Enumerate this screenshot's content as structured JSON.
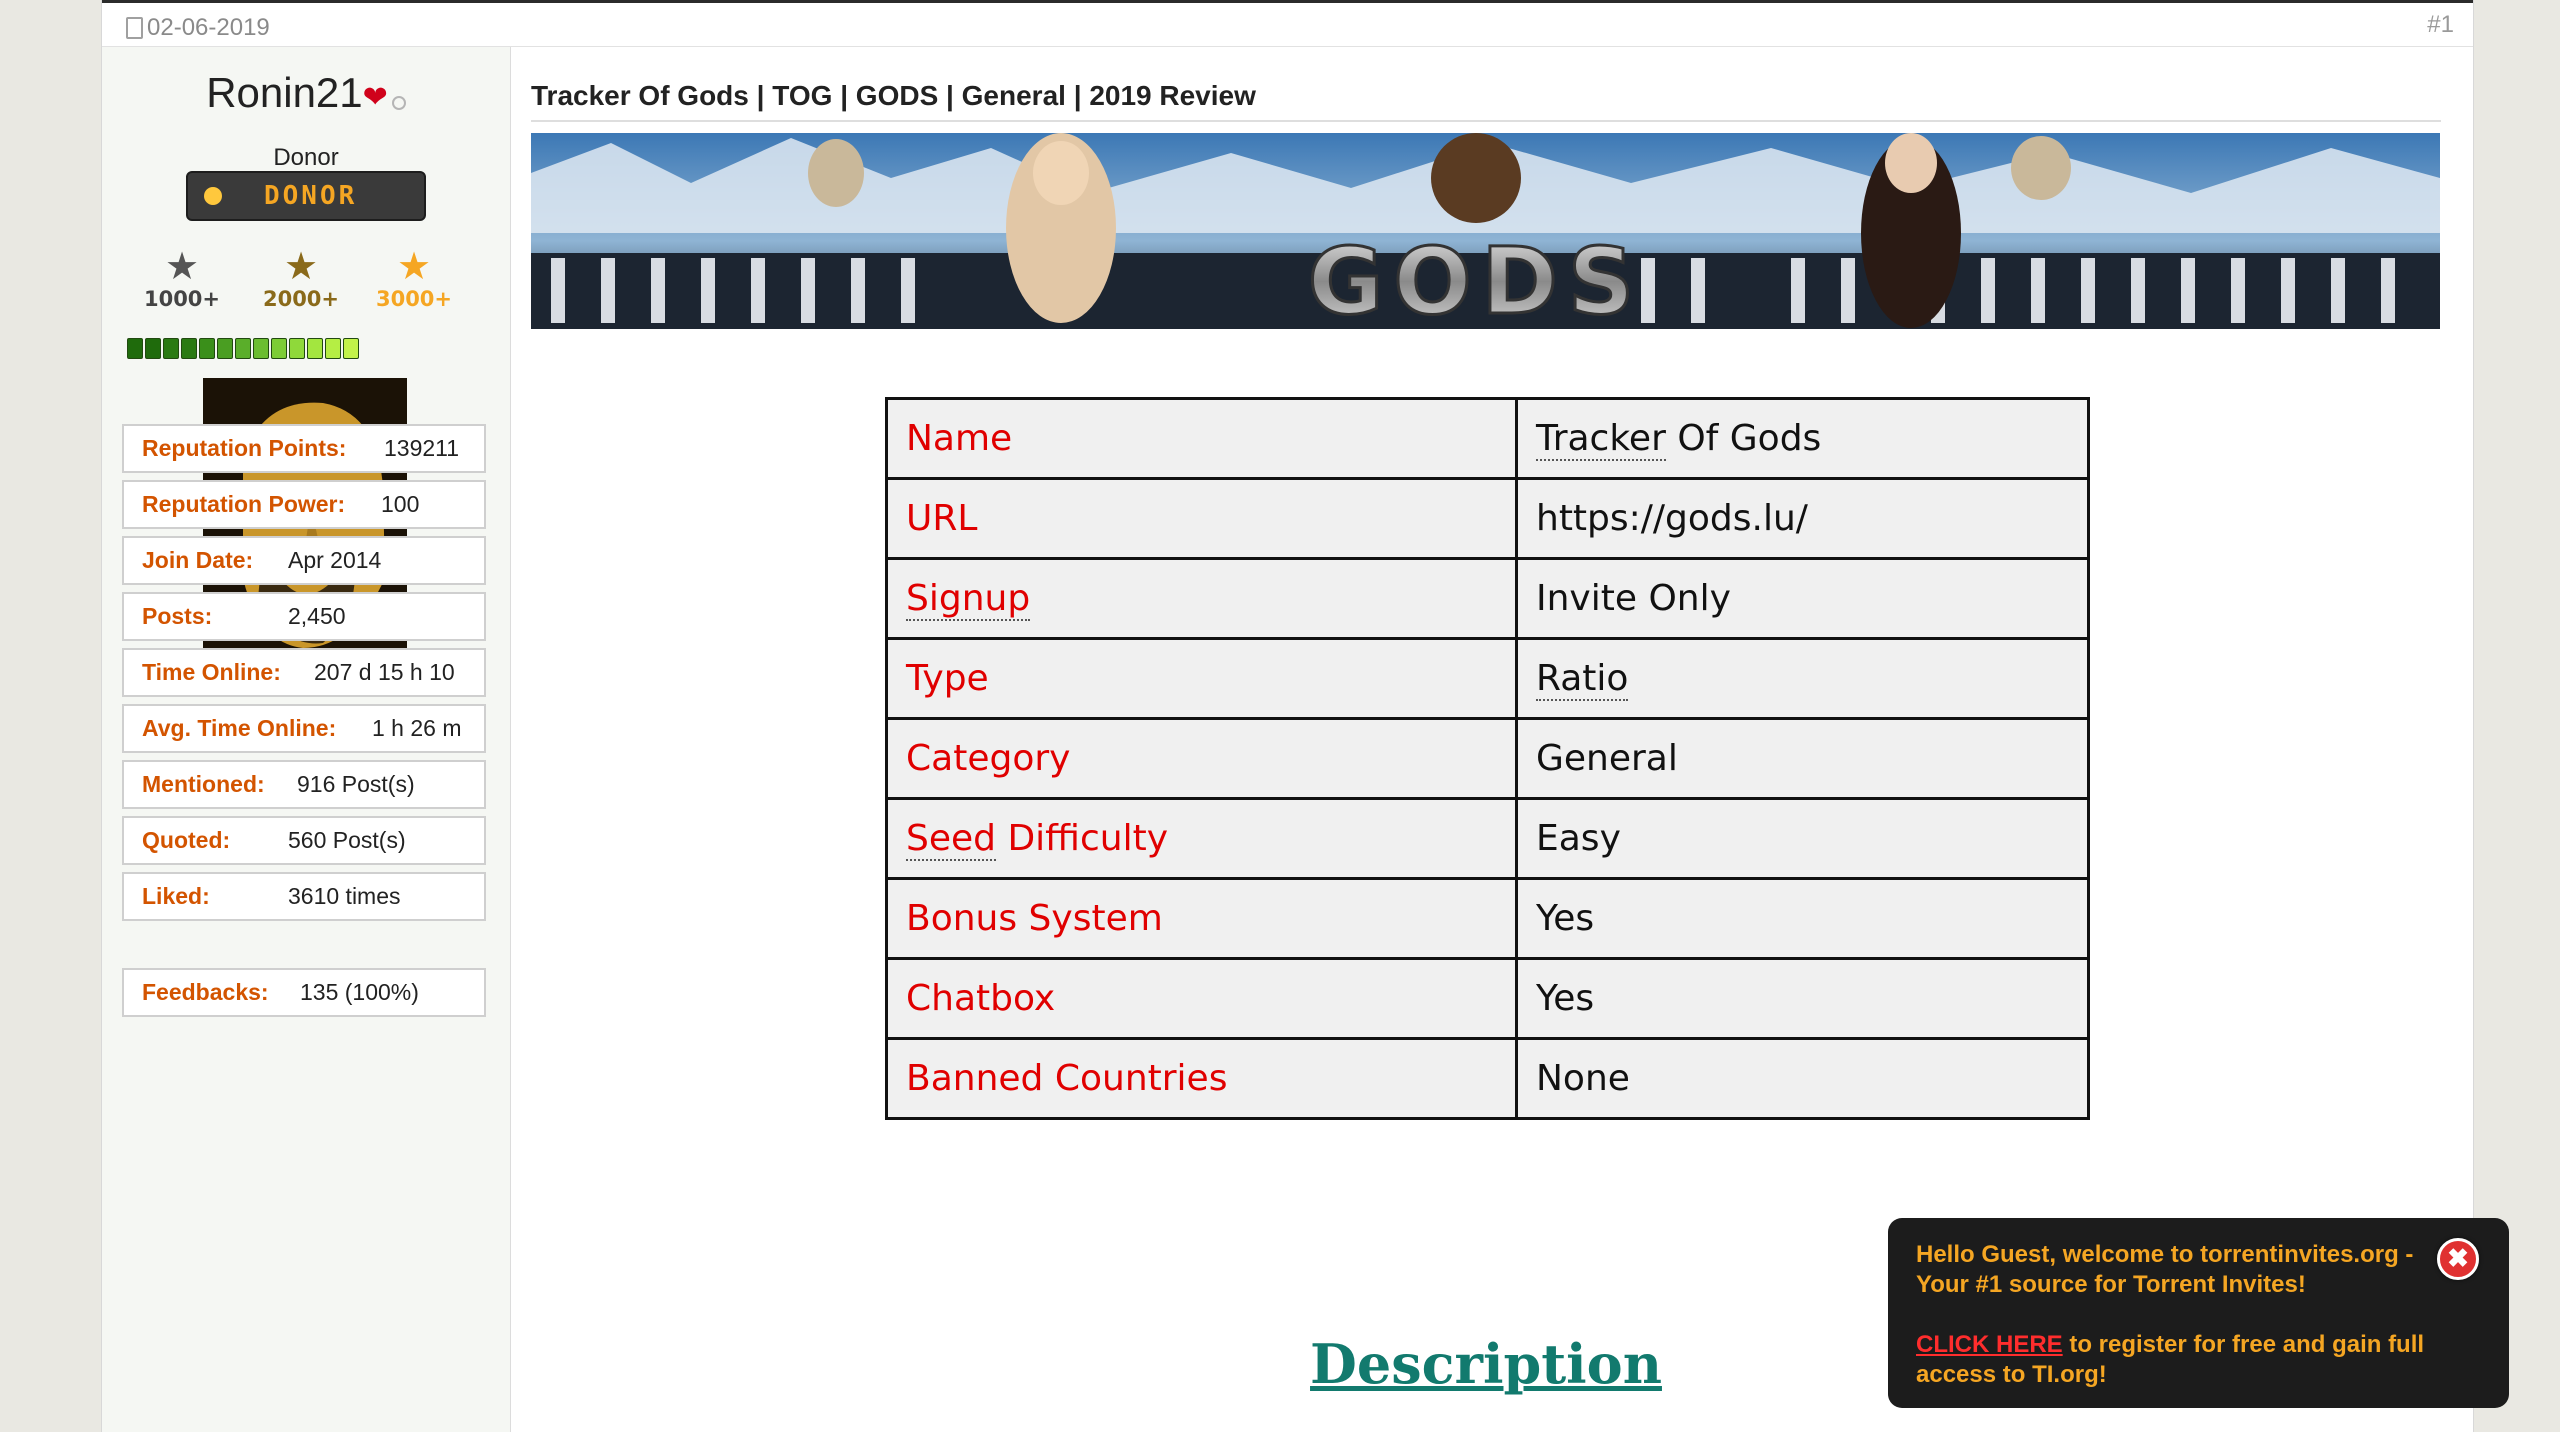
{
  "post": {
    "date": "02-06-2019",
    "number": "#1"
  },
  "user": {
    "name": "Ronin21",
    "title": "Donor",
    "badge_label": "DONOR",
    "stars": [
      {
        "label": "1000+",
        "color": "#5a5a5a"
      },
      {
        "label": "2000+",
        "color": "#8a6a1a"
      },
      {
        "label": "3000+",
        "color": "#f5a623"
      }
    ],
    "rep_bar_colors": [
      "#1f6b0c",
      "#1f6b0c",
      "#2a7a12",
      "#2a7a12",
      "#3a8f1a",
      "#4a9e22",
      "#5aae2a",
      "#6bbd30",
      "#7ccc35",
      "#8fd93a",
      "#a3e63f",
      "#b5ee44",
      "#c2f34a"
    ],
    "stats": [
      {
        "key": "Reputation Points:",
        "value": "139211"
      },
      {
        "key": "Reputation Power:",
        "value": "100"
      },
      {
        "key": "Join Date:",
        "value": "Apr 2014"
      },
      {
        "key": "Posts:",
        "value": "2,450"
      },
      {
        "key": "Time Online:",
        "value": "207 d 15 h 10"
      },
      {
        "key": "Avg. Time Online:",
        "value": "1 h 26 m"
      },
      {
        "key": "Mentioned:",
        "value": "916 Post(s)"
      },
      {
        "key": "Quoted:",
        "value": "560 Post(s)"
      },
      {
        "key": "Liked:",
        "value": "3610 times"
      },
      {
        "key": "Feedbacks:",
        "value": "135 (100%)"
      }
    ],
    "time_online_overflow": "m"
  },
  "content": {
    "title": "Tracker Of Gods | TOG | GODS | General | 2019 Review",
    "banner_text": "GODS",
    "table": [
      {
        "key": "Name",
        "value": "Tracker Of Gods"
      },
      {
        "key": "URL",
        "value": "https://gods.lu/"
      },
      {
        "key": "Signup",
        "value": "Invite Only"
      },
      {
        "key": "Type",
        "value": "Ratio"
      },
      {
        "key": "Category",
        "value": "General"
      },
      {
        "key": "Seed Difficulty",
        "value": "Easy"
      },
      {
        "key": "Bonus System",
        "value": "Yes"
      },
      {
        "key": "Chatbox",
        "value": "Yes"
      },
      {
        "key": "Banned Countries",
        "value": "None"
      }
    ],
    "description_heading": "Description"
  },
  "popup": {
    "welcome": "Hello Guest, welcome to torrentinvites.org - Your #1 source for Torrent Invites!",
    "link_text": "CLICK HERE",
    "link_rest": " to register for free and gain full access to TI.org!",
    "close_symbol": "✖"
  }
}
